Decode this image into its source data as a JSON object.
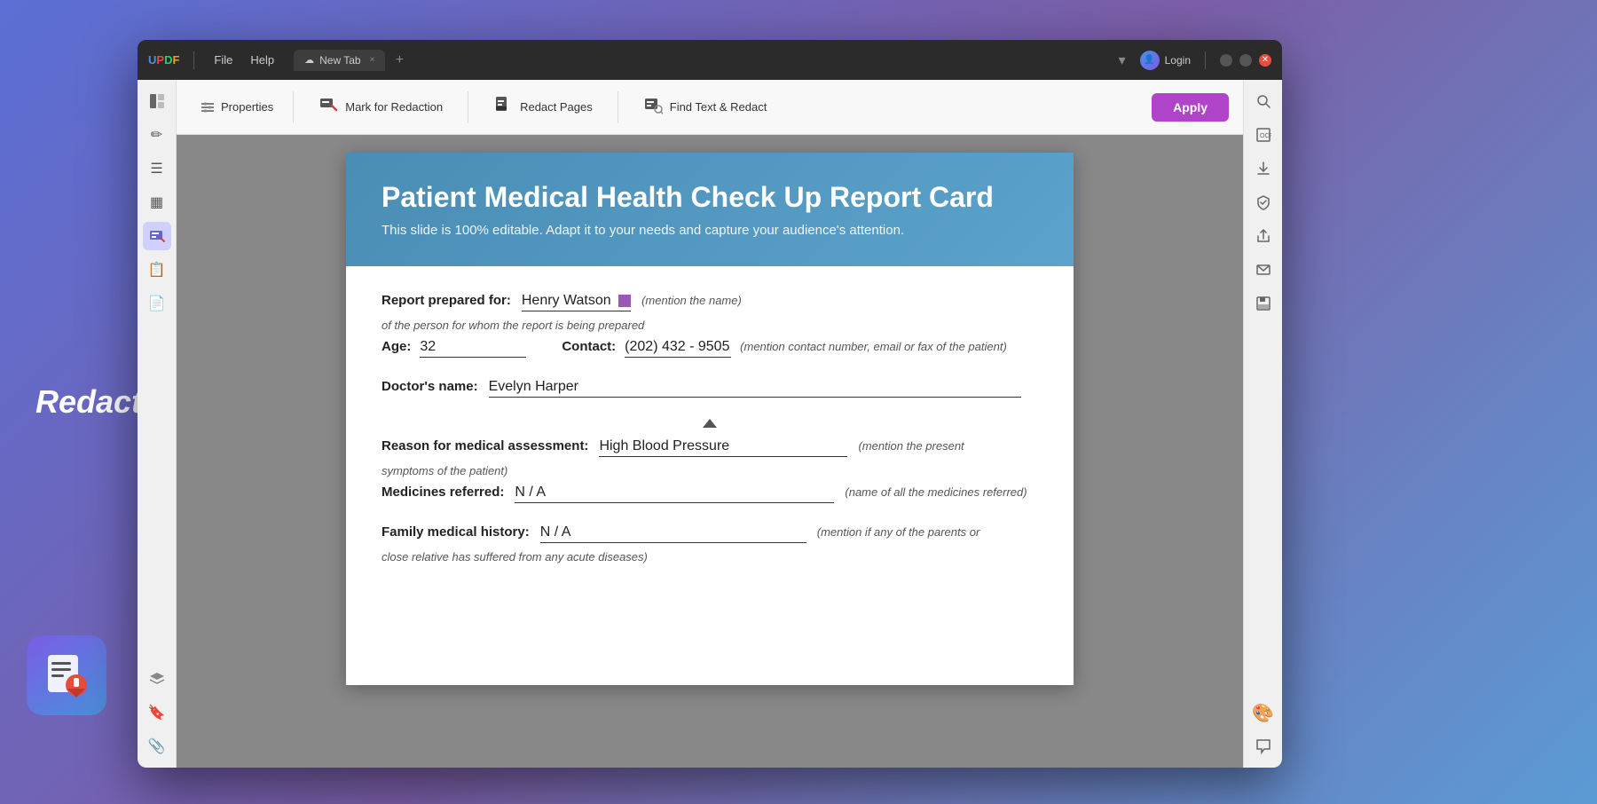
{
  "app": {
    "logo": {
      "u": "U",
      "p": "P",
      "d": "D",
      "f": "F"
    },
    "menu": [
      "File",
      "Help"
    ],
    "tab": {
      "icon": "☁",
      "label": "New Tab",
      "close": "×"
    },
    "tab_add": "+",
    "login": "Login",
    "window_controls": {
      "min": "—",
      "max": "□",
      "close": "×"
    }
  },
  "toolbar": {
    "properties_label": "Properties",
    "mark_for_redaction_label": "Mark for Redaction",
    "redact_pages_label": "Redact Pages",
    "find_text_redact_label": "Find Text & Redact",
    "apply_label": "Apply"
  },
  "sidebar_left": {
    "icons": [
      "≡",
      "✏",
      "☰",
      "▦",
      "📋",
      "📄",
      "📁"
    ]
  },
  "sidebar_right": {
    "icons": [
      "🔍",
      "⬛",
      "📥",
      "🔒",
      "📤",
      "✉",
      "💾",
      "🎨",
      "💬"
    ]
  },
  "pdf": {
    "header": {
      "title": "Patient Medical Health Check Up Report Card",
      "subtitle": "This slide is 100% editable. Adapt it to your needs and capture your audience's attention."
    },
    "form": {
      "report_prepared_for_label": "Report prepared for:",
      "report_prepared_for_value": "Henry Watson",
      "report_prepared_for_hint": "(mention the name)",
      "report_prepared_for_subtext": "of the person for whom the report is being prepared",
      "age_label": "Age:",
      "age_value": "32",
      "contact_label": "Contact:",
      "contact_value": "(202) 432 - 9505",
      "contact_hint": "(mention contact number, email or fax of the patient)",
      "doctors_name_label": "Doctor's name:",
      "doctors_name_value": "Evelyn  Harper",
      "reason_label": "Reason for medical assessment:",
      "reason_value": "High Blood Pressure",
      "reason_hint": "(mention the present",
      "reason_subtext": "symptoms of the patient)",
      "medicines_label": "Medicines referred:",
      "medicines_value": "N / A",
      "medicines_hint": "(name of all the medicines referred)",
      "family_history_label": "Family medical history:",
      "family_history_value": "N / A",
      "family_history_hint": "(mention if any of the parents or",
      "family_history_subtext": "close relative has suffered from any acute diseases)"
    }
  },
  "redact_label": "Redact"
}
